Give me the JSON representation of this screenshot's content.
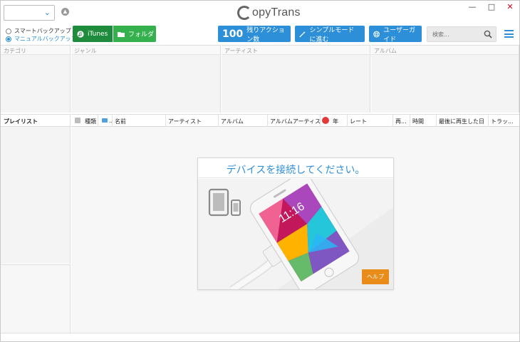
{
  "app": {
    "logo_text": "opyTrans"
  },
  "device_select": {
    "value": ""
  },
  "backup_mode": {
    "options": [
      {
        "label": "スマートバックアップ",
        "selected": false
      },
      {
        "label": "マニュアルバックアップ",
        "selected": true
      }
    ]
  },
  "source": {
    "itunes_label": "iTunes",
    "folder_label": "フォルダ"
  },
  "toolbar": {
    "actions_count": "100",
    "actions_label": "残りアクション数",
    "simple_mode_label": "シンプルモードに進む",
    "user_guide_label": "ユーザーガイド"
  },
  "search": {
    "placeholder": "検索..."
  },
  "panes": {
    "category": "カテゴリ",
    "genre": "ジャンル",
    "artist": "アーティスト",
    "album": "アルバム"
  },
  "playlist": {
    "header": "プレイリスト"
  },
  "tracks": {
    "columns": [
      {
        "label": "種類"
      },
      {
        "label": "..."
      },
      {
        "label": "名前"
      },
      {
        "label": "アーティスト"
      },
      {
        "label": "アルバム"
      },
      {
        "label": "アルバムアーティスト"
      },
      {
        "label": "年"
      },
      {
        "label": "レート"
      },
      {
        "label": "再..."
      },
      {
        "label": "時間"
      },
      {
        "label": "最後に再生した日"
      },
      {
        "label": "トラッ..."
      }
    ]
  },
  "connect_card": {
    "title": "デバイスを接続してください。",
    "phone_time": "11:16",
    "help_label": "ヘルプ"
  },
  "colors": {
    "accent_blue": "#2e8fd9",
    "itunes_green": "#1f8c3d",
    "folder_green": "#34b04c",
    "help_orange": "#e98c1a",
    "close_red": "#d0021b"
  }
}
